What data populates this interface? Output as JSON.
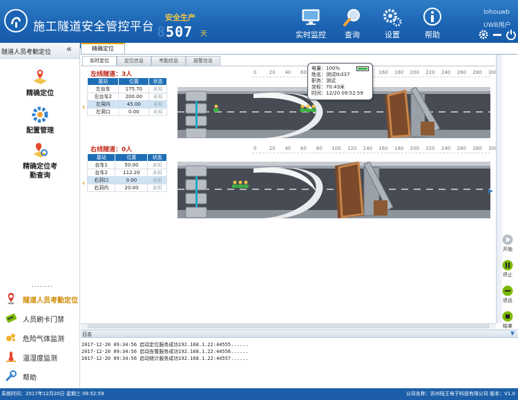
{
  "header": {
    "title": "施工隧道安全管控平台",
    "safety_label": "安全生产",
    "safety_days_dim": "8",
    "safety_days": "507",
    "safety_unit": "天",
    "nav": [
      {
        "label": "实时监控",
        "icon": "monitor-icon"
      },
      {
        "label": "查询",
        "icon": "search-icon"
      },
      {
        "label": "设置",
        "icon": "gear-icon"
      },
      {
        "label": "帮助",
        "icon": "info-icon"
      }
    ],
    "user_name": "lohouwb",
    "user_role": "UWB用户"
  },
  "sidebar": {
    "title": "隧道人员考勤定位",
    "collapse": "«",
    "menu": [
      {
        "label": "精确定位",
        "icon": "map-pin-icon"
      },
      {
        "label": "配置管理",
        "icon": "config-gear-icon"
      },
      {
        "label": "精确定位考勤查询",
        "label_line1": "精确定位考",
        "label_line2": "勤查询",
        "icon": "attendance-search-icon"
      }
    ],
    "dots": "........",
    "modules": [
      {
        "label": "隧道人员考勤定位",
        "icon": "location-pin-icon",
        "active": true
      },
      {
        "label": "人员刷卡门禁",
        "icon": "card-icon"
      },
      {
        "label": "危险气体监测",
        "icon": "gas-icon"
      },
      {
        "label": "温湿度监测",
        "icon": "thermometer-icon"
      },
      {
        "label": "帮助",
        "icon": "wrench-icon"
      }
    ]
  },
  "main": {
    "outer_tab": "精确定位",
    "subtabs": [
      "实时定位",
      "定位信息",
      "考勤信息",
      "报警信息"
    ],
    "left_tunnel": {
      "title": "左线隧道：3人",
      "headers": [
        "基站",
        "位置",
        "状态"
      ],
      "rows": [
        {
          "station": "左台车",
          "pos": "175.70",
          "status": "未知"
        },
        {
          "station": "左台车2",
          "pos": "200.00",
          "status": "未知"
        },
        {
          "station": "左洞内",
          "pos": "45.00",
          "status": "未知"
        },
        {
          "station": "左洞口",
          "pos": "0.00",
          "status": "未知"
        }
      ]
    },
    "right_tunnel": {
      "title": "右线隧道：0人",
      "headers": [
        "基站",
        "位置",
        "状态"
      ],
      "rows": [
        {
          "station": "台车1",
          "pos": "50.00",
          "status": "未知"
        },
        {
          "station": "台车2",
          "pos": "112.20",
          "status": "未知"
        },
        {
          "station": "右洞口",
          "pos": "0.00",
          "status": "未知"
        },
        {
          "station": "右洞内",
          "pos": "20.00",
          "status": "未知"
        }
      ]
    },
    "scale_ticks": [
      "0",
      "20",
      "40",
      "60",
      "80",
      "100",
      "120",
      "140",
      "160",
      "180",
      "200",
      "220",
      "240",
      "260",
      "280",
      "300"
    ],
    "tooltip": {
      "battery": "电量：100%",
      "name": "姓名：测试tb337",
      "job": "职务：测试",
      "coord": "坐标：70.43米",
      "time": "时间：12/20 09:52:59"
    },
    "controls": [
      {
        "label": "开始",
        "color": "#b9bfc6"
      },
      {
        "label": "停止",
        "color": "#7ab800"
      },
      {
        "label": "退出",
        "color": "#7ab800"
      },
      {
        "label": "结束",
        "color": "#7ab800"
      }
    ]
  },
  "log": {
    "title": "日志",
    "lines": [
      "2017-12-20 09:34:56   启动定位服务成功192.168.1.22:44555......",
      "2017-12-20 09:34:56   启动告警服务成功192.168.1.22:44556......",
      "2017-12-20 09:34:56   启动统计服务成功192.168.1.22:44557......"
    ]
  },
  "status_bar": {
    "left": "系统时间：2017年12月20日 星期三 09:52:59",
    "right": "公司名称：苏州陆王电子科技有限公司  版本：V1.0"
  }
}
